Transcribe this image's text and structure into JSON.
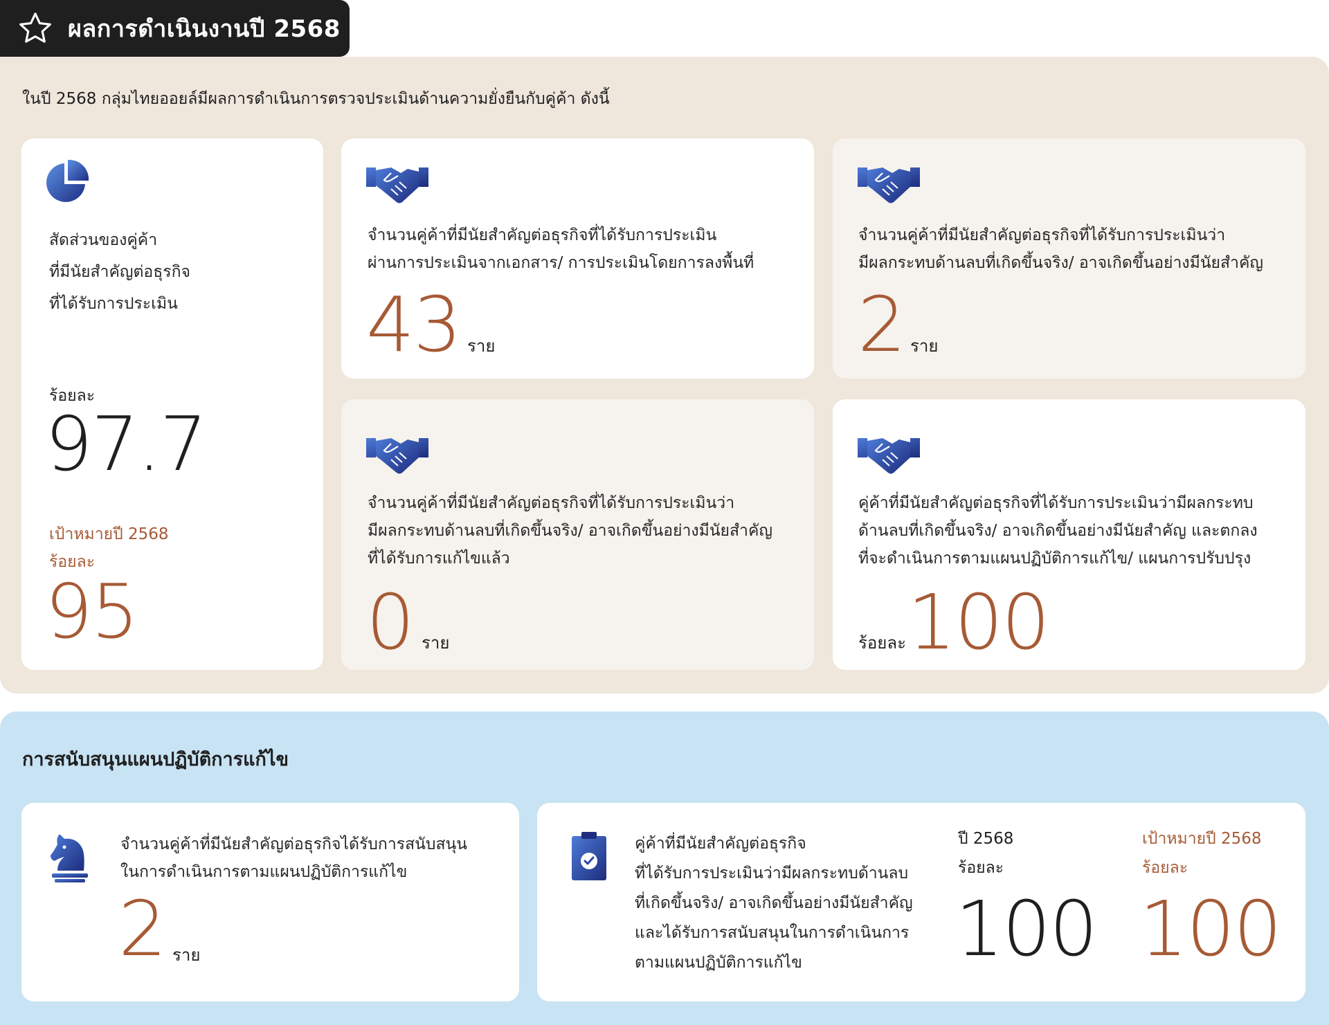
{
  "header": {
    "title": "ผลการดำเนินงานปี 2568"
  },
  "intro": "ในปี 2568 กลุ่มไทยออยล์มีผลการดำเนินการตรวจประเมินด้านความยั่งยืนกับคู่ค้า ดังนี้",
  "ratio_card": {
    "lines": [
      "สัดส่วนของคู่ค้า",
      "ที่มีนัยสำคัญต่อธุรกิจ",
      "ที่ได้รับการประเมิน"
    ],
    "percent_label": "ร้อยละ",
    "value": "97.7",
    "target_label": "เป้าหมายปี 2568",
    "target_percent_label": "ร้อยละ",
    "target_value": "95"
  },
  "card_assessed": {
    "lines": [
      "จำนวนคู่ค้าที่มีนัยสำคัญต่อธุรกิจที่ได้รับการประเมิน",
      "ผ่านการประเมินจากเอกสาร/ การประเมินโดยการลงพื้นที่"
    ],
    "value": "43",
    "unit": "ราย"
  },
  "card_negative": {
    "lines": [
      "จำนวนคู่ค้าที่มีนัยสำคัญต่อธุรกิจที่ได้รับการประเมินว่า",
      "มีผลกระทบด้านลบที่เกิดขึ้นจริง/ อาจเกิดขึ้นอย่างมีนัยสำคัญ"
    ],
    "value": "2",
    "unit": "ราย"
  },
  "card_fixed": {
    "lines": [
      "จำนวนคู่ค้าที่มีนัยสำคัญต่อธุรกิจที่ได้รับการประเมินว่า",
      "มีผลกระทบด้านลบที่เกิดขึ้นจริง/ อาจเกิดขึ้นอย่างมีนัยสำคัญ",
      "ที่ได้รับการแก้ไขแล้ว"
    ],
    "value": "0",
    "unit": "ราย"
  },
  "card_agreed": {
    "lines": [
      "คู่ค้าที่มีนัยสำคัญต่อธุรกิจที่ได้รับการประเมินว่ามีผลกระทบ",
      "ด้านลบที่เกิดขึ้นจริง/ อาจเกิดขึ้นอย่างมีนัยสำคัญ และตกลง",
      "ที่จะดำเนินการตามแผนปฏิบัติการแก้ไข/ แผนการปรับปรุง"
    ],
    "percent_label": "ร้อยละ",
    "value": "100"
  },
  "support_section": {
    "title": "การสนับสนุนแผนปฏิบัติการแก้ไข",
    "count_card": {
      "lines": [
        "จำนวนคู่ค้าที่มีนัยสำคัญต่อธุรกิจได้รับการสนับสนุน",
        "ในการดำเนินการตามแผนปฏิบัติการแก้ไข"
      ],
      "value": "2",
      "unit": "ราย"
    },
    "rate_card": {
      "lines": [
        "คู่ค้าที่มีนัยสำคัญต่อธุรกิจ",
        "ที่ได้รับการประเมินว่ามีผลกระทบด้านลบ",
        "ที่เกิดขึ้นจริง/ อาจเกิดขึ้นอย่างมีนัยสำคัญ",
        "และได้รับการสนับสนุนในการดำเนินการ",
        "ตามแผนปฏิบัติการแก้ไข"
      ],
      "year_label": "ปี 2568",
      "year_percent_label": "ร้อยละ",
      "year_value": "100",
      "target_label": "เป้าหมายปี 2568",
      "target_percent_label": "ร้อยละ",
      "target_value": "100"
    }
  },
  "colors": {
    "accent": "#a65a35",
    "beige_panel": "#efe6dc",
    "blue_panel": "#c8e3f4",
    "icon_blue": "#2f4ea8"
  },
  "icons": [
    "star-icon",
    "pie-chart-icon",
    "handshake-icon",
    "chess-knight-icon",
    "clipboard-check-icon"
  ]
}
